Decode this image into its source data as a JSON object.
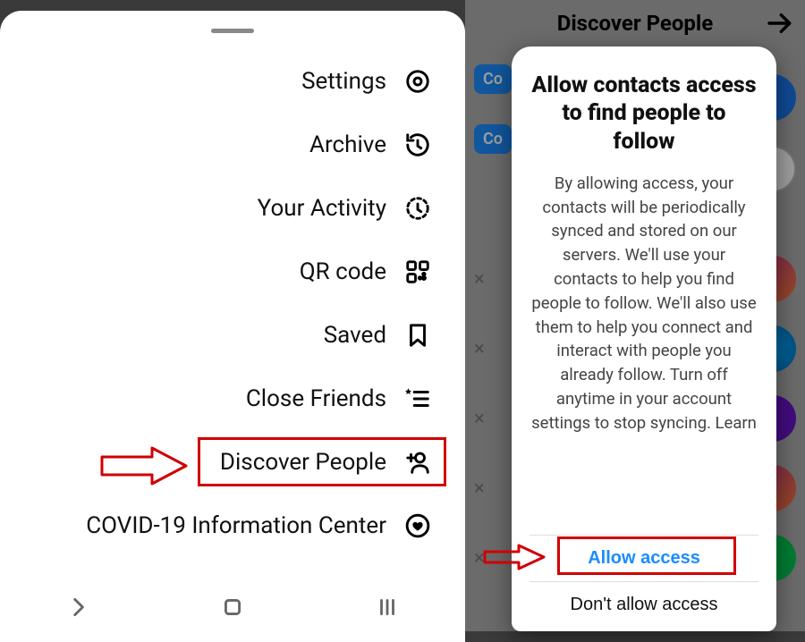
{
  "left": {
    "menu": [
      {
        "label": "Settings"
      },
      {
        "label": "Archive"
      },
      {
        "label": "Your Activity"
      },
      {
        "label": "QR code"
      },
      {
        "label": "Saved"
      },
      {
        "label": "Close Friends"
      },
      {
        "label": "Discover People"
      },
      {
        "label": "COVID-19 Information Center"
      }
    ]
  },
  "right": {
    "header_title": "Discover People",
    "connect_label": "Co",
    "modal": {
      "title": "Allow contacts access to find people to follow",
      "body": "By allowing access, your contacts will be periodically synced and stored on our servers. We'll use your contacts to help you find people to follow. We'll also use them to help you connect and interact with people you already follow. Turn off anytime in your account settings to stop syncing. Learn",
      "primary": "Allow access",
      "secondary": "Don't allow access"
    }
  }
}
